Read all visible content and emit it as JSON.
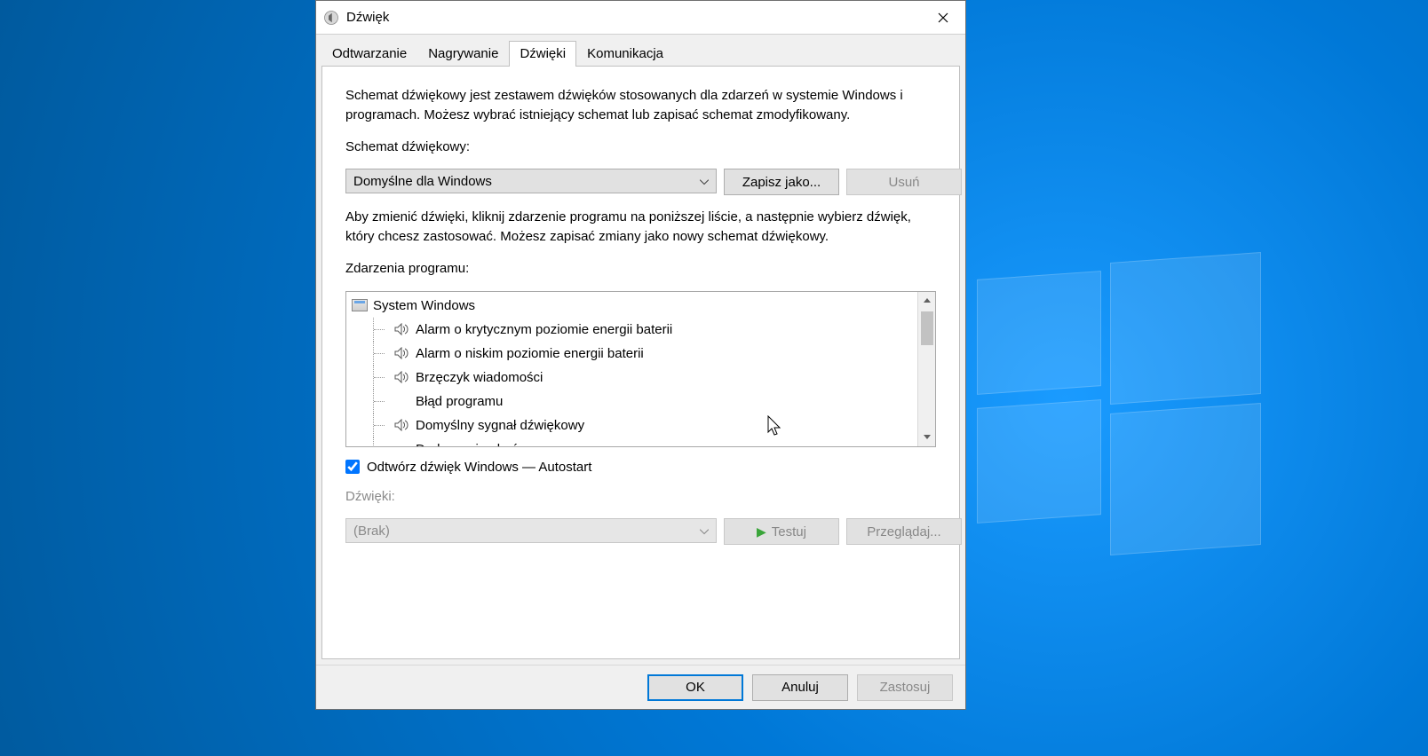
{
  "window": {
    "title": "Dźwięk"
  },
  "tabs": [
    {
      "label": "Odtwarzanie"
    },
    {
      "label": "Nagrywanie"
    },
    {
      "label": "Dźwięki"
    },
    {
      "label": "Komunikacja"
    }
  ],
  "sounds": {
    "intro": "Schemat dźwiękowy jest zestawem dźwięków stosowanych dla zdarzeń w systemie Windows i programach. Możesz wybrać istniejący schemat lub zapisać schemat zmodyfikowany.",
    "scheme_label": "Schemat dźwiękowy:",
    "scheme_value": "Domyślne dla Windows",
    "save_as": "Zapisz jako...",
    "delete": "Usuń",
    "change_help": "Aby zmienić dźwięki, kliknij zdarzenie programu na poniższej liście, a następnie wybierz dźwięk, który chcesz zastosować. Możesz zapisać zmiany jako nowy schemat dźwiękowy.",
    "events_label": "Zdarzenia programu:",
    "tree_root": "System Windows",
    "events": [
      {
        "label": "Alarm o krytycznym poziomie energii baterii",
        "has_sound": true
      },
      {
        "label": "Alarm o niskim poziomie energii baterii",
        "has_sound": true
      },
      {
        "label": "Brzęczyk wiadomości",
        "has_sound": true
      },
      {
        "label": "Błąd programu",
        "has_sound": false
      },
      {
        "label": "Domyślny sygnał dźwiękowy",
        "has_sound": true
      },
      {
        "label": "Drukowanie ukończone",
        "has_sound": false
      }
    ],
    "play_startup": "Odtwórz dźwięk Windows — Autostart",
    "sounds_label": "Dźwięki:",
    "sound_value": "(Brak)",
    "test": "Testuj",
    "browse": "Przeglądaj..."
  },
  "buttons": {
    "ok": "OK",
    "cancel": "Anuluj",
    "apply": "Zastosuj"
  }
}
